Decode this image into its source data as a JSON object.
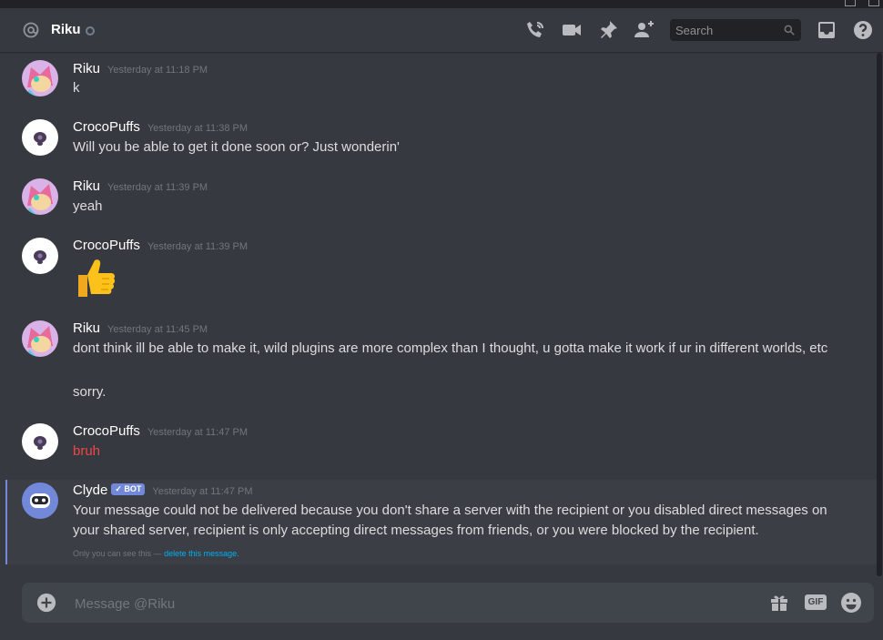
{
  "header": {
    "channel_name": "Riku",
    "search_placeholder": "Search"
  },
  "messages": [
    {
      "author": "Riku",
      "timestamp": "Yesterday at 11:18 PM",
      "lines": [
        "k"
      ]
    },
    {
      "author": "CrocoPuffs",
      "timestamp": "Yesterday at 11:38 PM",
      "lines": [
        "Will you be able to get it done soon or? Just wonderin'"
      ]
    },
    {
      "author": "Riku",
      "timestamp": "Yesterday at 11:39 PM",
      "lines": [
        "yeah"
      ]
    },
    {
      "author": "CrocoPuffs",
      "timestamp": "Yesterday at 11:39 PM",
      "emoji": "👍"
    },
    {
      "author": "Riku",
      "timestamp": "Yesterday at 11:45 PM",
      "lines": [
        "dont think ill be able to make it, wild plugins are more complex than I thought, u gotta make it work if ur in different worlds, etc",
        "sorry."
      ]
    },
    {
      "author": "CrocoPuffs",
      "timestamp": "Yesterday at 11:47 PM",
      "lines": [
        "bruh"
      ]
    },
    {
      "author": "Clyde",
      "bot_tag": "✓ BOT",
      "timestamp": "Yesterday at 11:47 PM",
      "lines": [
        "Your message could not be delivered because you don't share a server with the recipient or you disabled direct messages on your shared server, recipient is only accepting direct messages from friends, or you were blocked by the recipient."
      ],
      "ephemeral_note": "Only you can see this —",
      "ephemeral_link": "delete this message."
    }
  ],
  "composer": {
    "placeholder": "Message @Riku",
    "gif_label": "GIF"
  },
  "colors": {
    "background": "#36393f",
    "accent": "#7289da",
    "error_text": "#f04747",
    "link": "#00b0f4"
  },
  "icons": [
    "at-icon",
    "phone-call-icon",
    "video-icon",
    "pin-icon",
    "add-friend-icon",
    "search-icon",
    "inbox-icon",
    "help-icon",
    "add-attachment-icon",
    "gift-icon",
    "gif-icon",
    "emoji-icon"
  ]
}
